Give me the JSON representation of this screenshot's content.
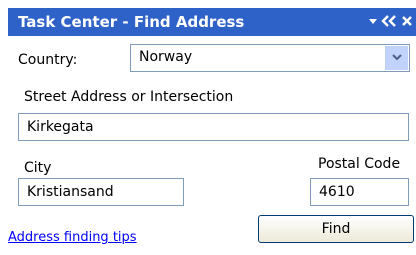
{
  "title_bar": {
    "title": "Task Center - Find Address",
    "dropdown_icon": "down-triangle-icon",
    "collapse_icon": "double-chevron-left-icon",
    "close_icon": "close-icon",
    "background_color": "#2f62c8"
  },
  "country": {
    "label": "Country:",
    "selected": "Norway"
  },
  "street": {
    "label": "Street Address or Intersection",
    "value": "Kirkegata"
  },
  "city": {
    "label": "City",
    "value": "Kristiansand"
  },
  "postal": {
    "label": "Postal Code",
    "value": "4610"
  },
  "actions": {
    "tips_link": "Address finding tips",
    "find_button": "Find"
  }
}
